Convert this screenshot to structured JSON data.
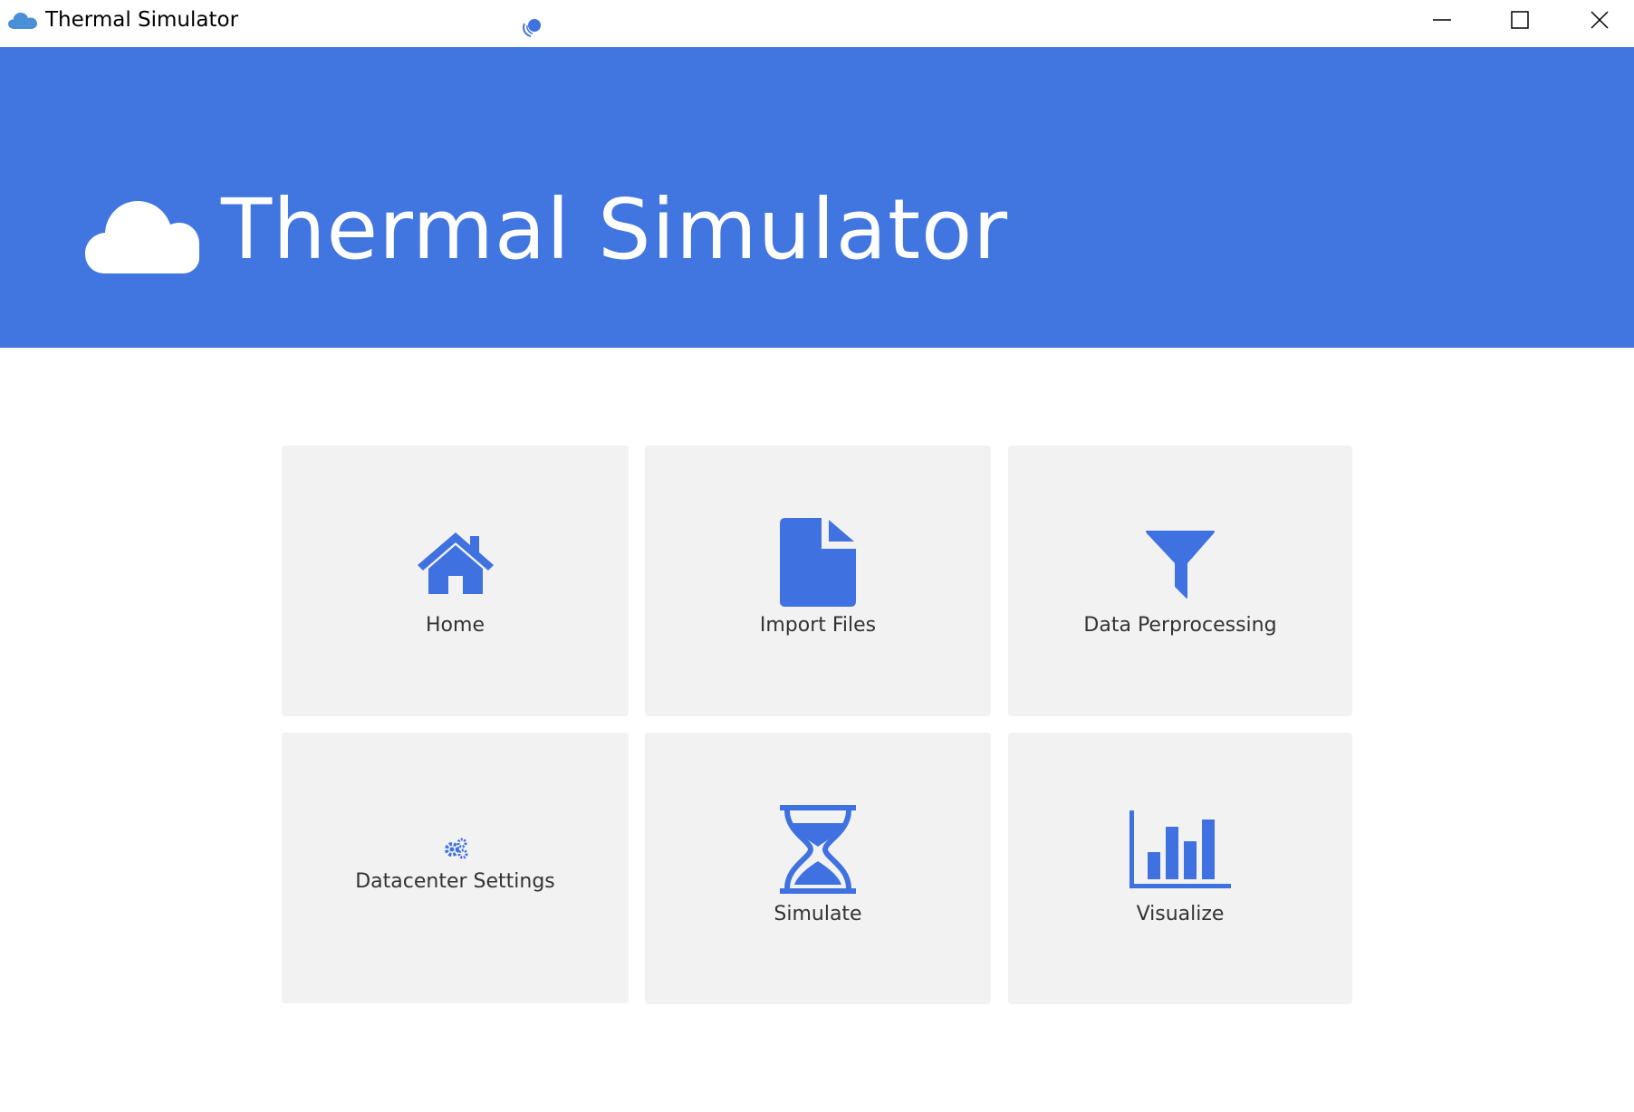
{
  "window": {
    "title": "Thermal Simulator",
    "app_icon": "cloud-icon",
    "controls": {
      "minimize": "minimize-icon",
      "maximize": "maximize-icon",
      "close": "close-icon"
    }
  },
  "header": {
    "title": "Thermal Simulator",
    "icon": "cloud-icon",
    "background_color": "#4175e0"
  },
  "tiles": [
    {
      "label": "Home",
      "icon": "home-icon"
    },
    {
      "label": "Import Files",
      "icon": "file-icon"
    },
    {
      "label": "Data Perprocessing",
      "icon": "filter-icon"
    },
    {
      "label": "Datacenter Settings",
      "icon": "gears-icon"
    },
    {
      "label": "Simulate",
      "icon": "hourglass-icon"
    },
    {
      "label": "Visualize",
      "icon": "bar-chart-icon"
    }
  ],
  "colors": {
    "accent": "#3f72e0",
    "tile_background": "#f2f2f2",
    "label_text": "#333333"
  }
}
